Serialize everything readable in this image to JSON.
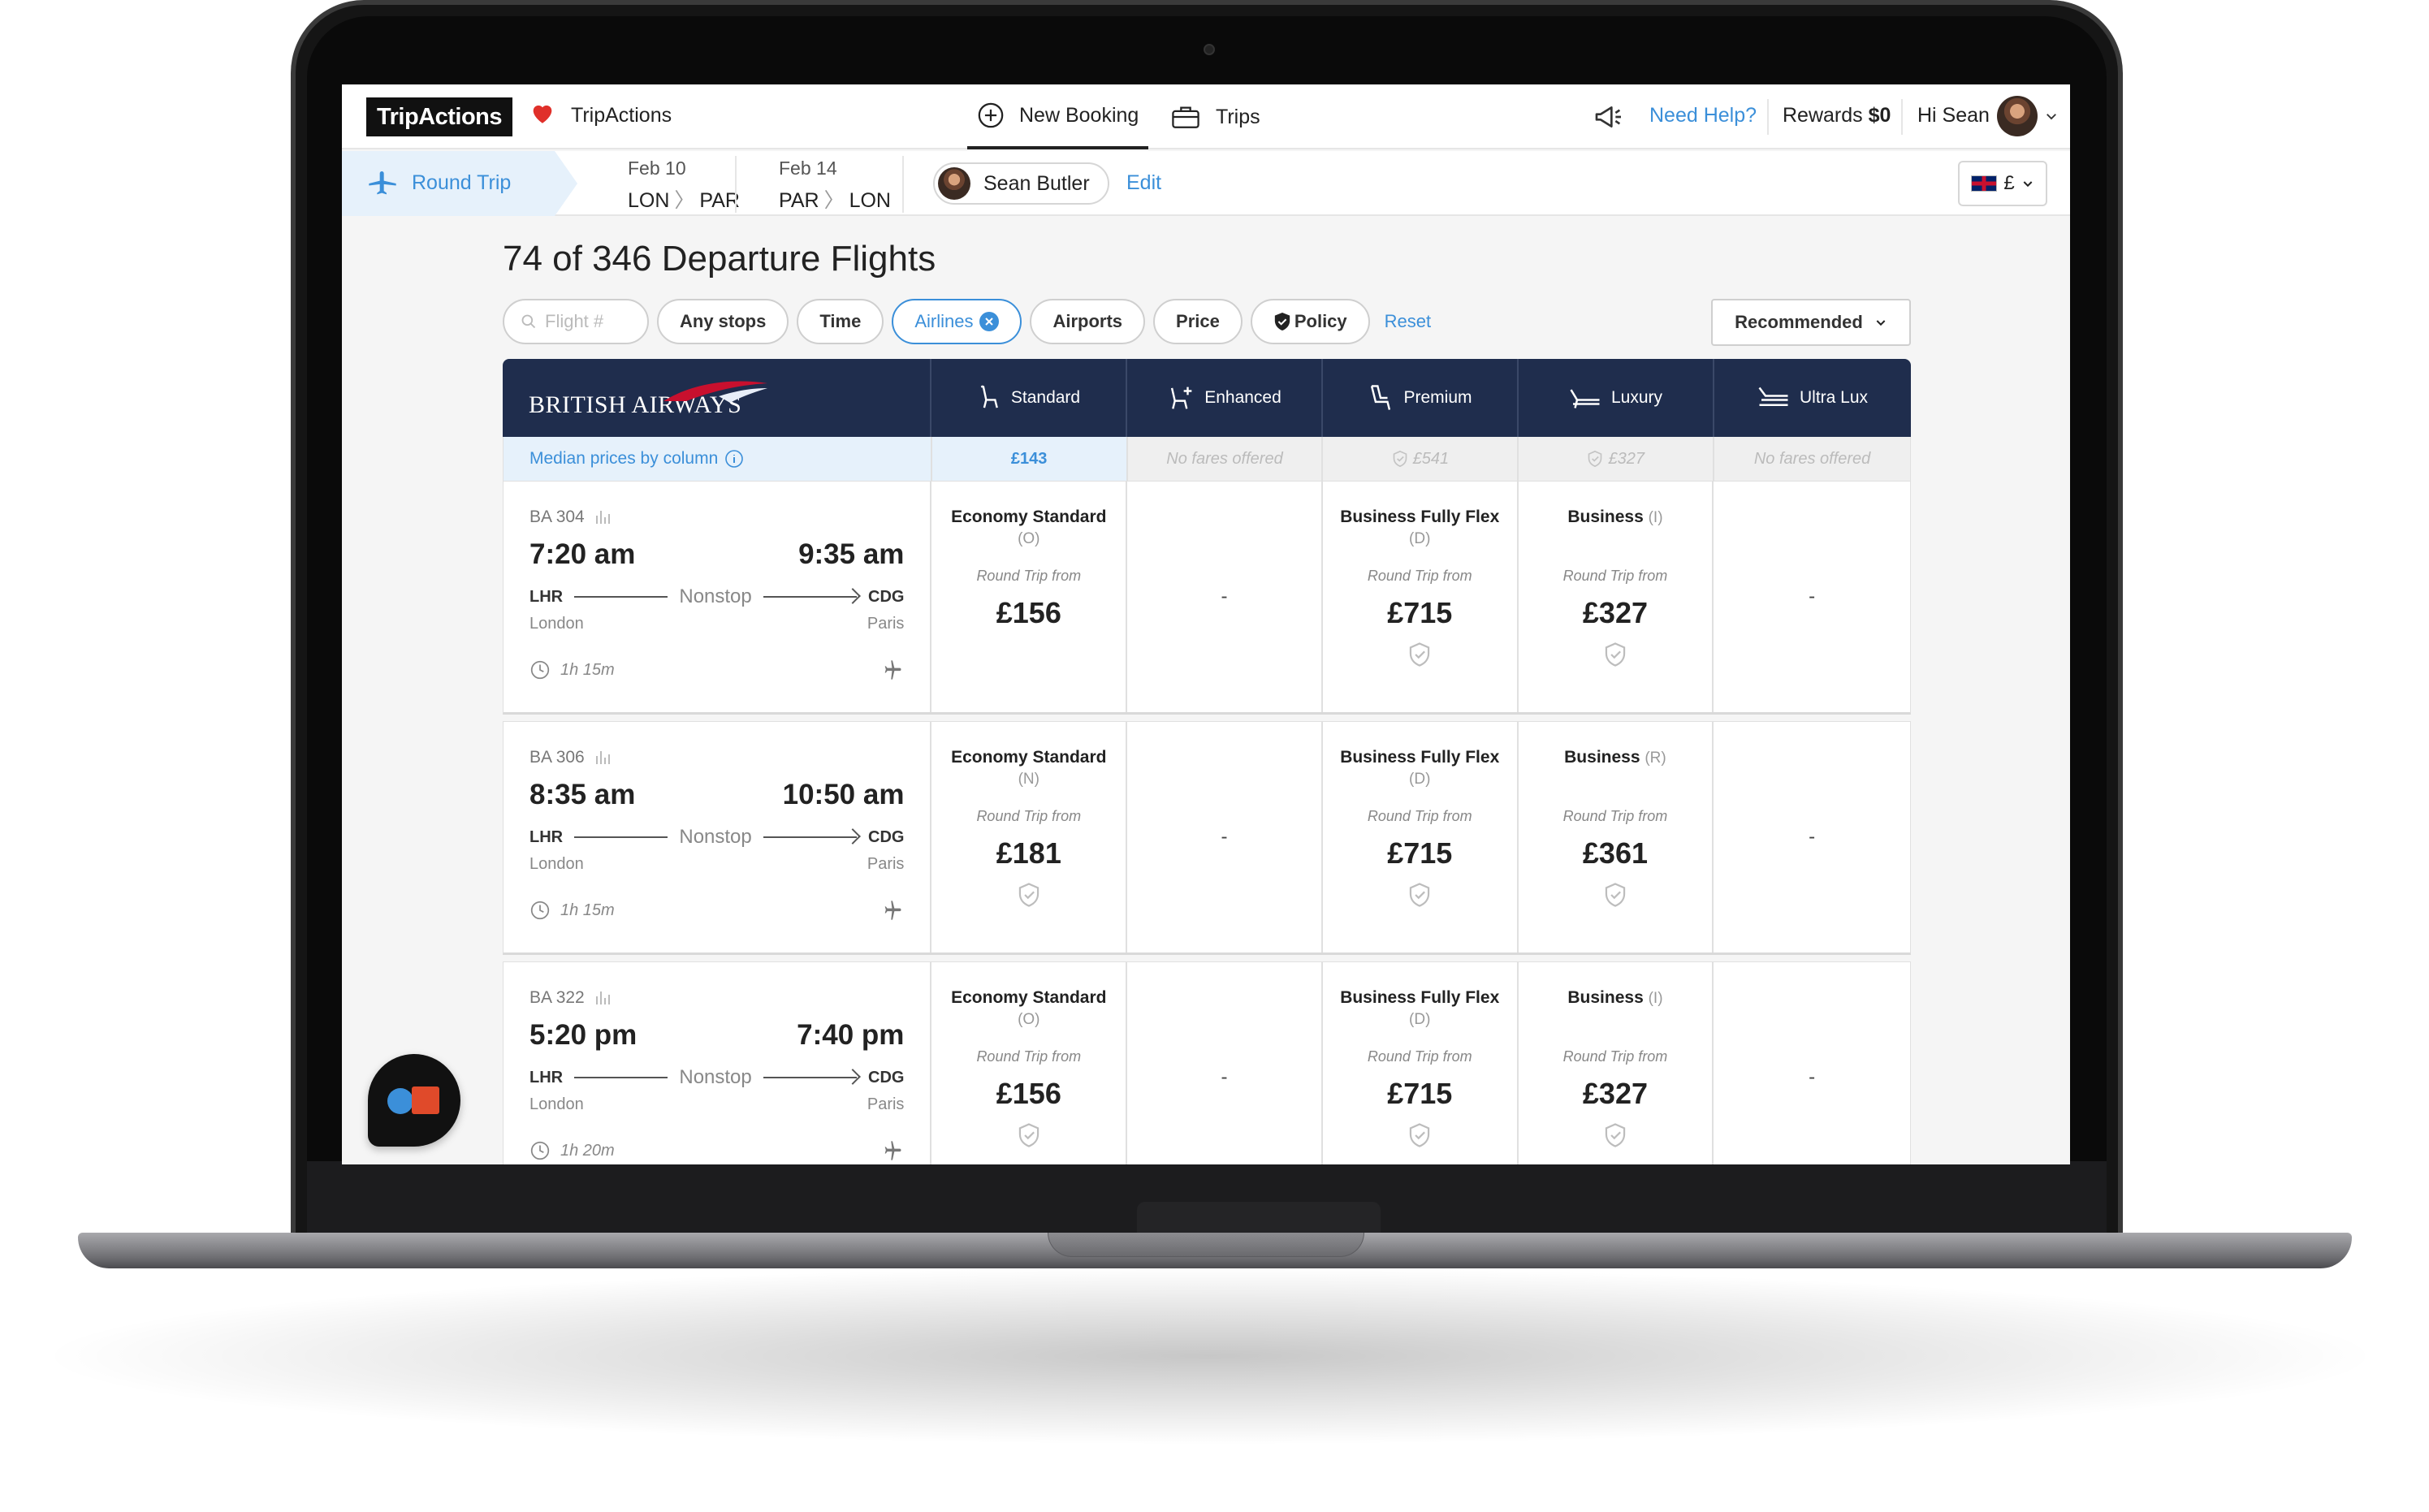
{
  "header": {
    "logo_text": "TripActions",
    "company_name": "TripActions",
    "nav_new_booking": "New Booking",
    "nav_trips": "Trips",
    "need_help": "Need Help?",
    "rewards_label": "Rewards",
    "rewards_value": "$0",
    "greeting": "Hi Sean"
  },
  "search_summary": {
    "trip_type": "Round Trip",
    "legs": [
      {
        "date": "Feb 10",
        "from": "LON",
        "to": "PAR"
      },
      {
        "date": "Feb 14",
        "from": "PAR",
        "to": "LON"
      }
    ],
    "traveler": "Sean Butler",
    "edit_label": "Edit",
    "currency_symbol": "£"
  },
  "results": {
    "title": "74 of 346 Departure Flights",
    "search_placeholder": "Flight #",
    "filters": [
      "Any stops",
      "Time",
      "Airlines",
      "Airports",
      "Price",
      "Policy"
    ],
    "reset_label": "Reset",
    "sort_label": "Recommended"
  },
  "grid": {
    "airline": "BRITISH AIRWAYS",
    "columns": [
      "Standard",
      "Enhanced",
      "Premium",
      "Luxury",
      "Ultra Lux"
    ],
    "median_label": "Median prices by column",
    "medians": [
      "£143",
      "No fares offered",
      "£541",
      "£327",
      "No fares offered"
    ],
    "round_trip_from": "Round Trip from",
    "nonstop": "Nonstop",
    "empty_cell": "-",
    "flights": [
      {
        "number": "BA 304",
        "depart": "7:20 am",
        "arrive": "9:35 am",
        "from_code": "LHR",
        "to_code": "CDG",
        "from_city": "London",
        "to_city": "Paris",
        "duration": "1h 15m",
        "fares": [
          {
            "name": "Economy Standard",
            "code": "(O)",
            "price": "£156"
          },
          null,
          {
            "name": "Business Fully Flex",
            "code": "(D)",
            "price": "£715"
          },
          {
            "name": "Business",
            "code": "(I)",
            "price": "£327"
          },
          null
        ]
      },
      {
        "number": "BA 306",
        "depart": "8:35 am",
        "arrive": "10:50 am",
        "from_code": "LHR",
        "to_code": "CDG",
        "from_city": "London",
        "to_city": "Paris",
        "duration": "1h 15m",
        "fares": [
          {
            "name": "Economy Standard",
            "code": "(N)",
            "price": "£181"
          },
          null,
          {
            "name": "Business Fully Flex",
            "code": "(D)",
            "price": "£715"
          },
          {
            "name": "Business",
            "code": "(R)",
            "price": "£361"
          },
          null
        ]
      },
      {
        "number": "BA 322",
        "depart": "5:20 pm",
        "arrive": "7:40 pm",
        "from_code": "LHR",
        "to_code": "CDG",
        "from_city": "London",
        "to_city": "Paris",
        "duration": "1h 20m",
        "fares": [
          {
            "name": "Economy Standard",
            "code": "(O)",
            "price": "£156"
          },
          null,
          {
            "name": "Business Fully Flex",
            "code": "(D)",
            "price": "£715"
          },
          {
            "name": "Business",
            "code": "(I)",
            "price": "£327"
          },
          null
        ]
      }
    ]
  },
  "colors": {
    "accent": "#3b8fd9",
    "header_navy": "#1f2d4d",
    "brand_red": "#e0302a"
  }
}
